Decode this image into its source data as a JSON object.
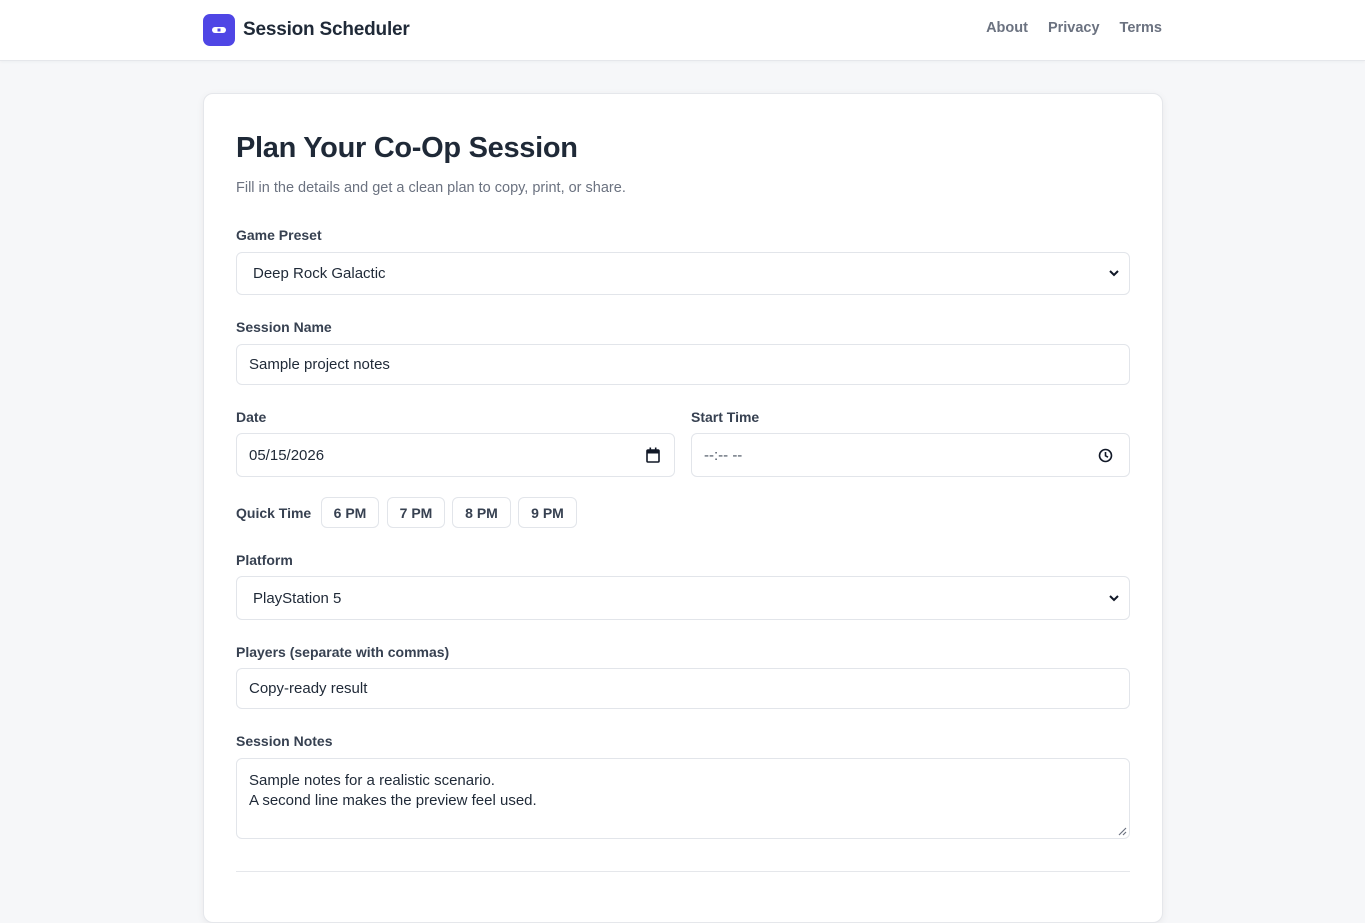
{
  "app": {
    "name": "Session Scheduler",
    "logo_icon": "gamepad-icon",
    "accent": "#4f46e5"
  },
  "nav": {
    "items": [
      "About",
      "Privacy",
      "Terms"
    ]
  },
  "form": {
    "title": "Plan Your Co-Op Session",
    "subtitle": "Fill in the details and get a clean plan to copy, print, or share.",
    "game_preset": {
      "label": "Game Preset",
      "value": "Deep Rock Galactic"
    },
    "session_name": {
      "label": "Session Name",
      "value": "Sample project notes"
    },
    "date": {
      "label": "Date",
      "value": "05/15/2026"
    },
    "start_time": {
      "label": "Start Time",
      "value": "--:-- --"
    },
    "quick_time": {
      "label": "Quick Time",
      "options": [
        "6 PM",
        "7 PM",
        "8 PM",
        "9 PM"
      ]
    },
    "platform": {
      "label": "Platform",
      "value": "PlayStation 5"
    },
    "players": {
      "label": "Players (separate with commas)",
      "value": "Copy-ready result"
    },
    "notes": {
      "label": "Session Notes",
      "lines": [
        "Sample notes for a realistic scenario.",
        "A second line makes the preview feel used."
      ]
    }
  }
}
